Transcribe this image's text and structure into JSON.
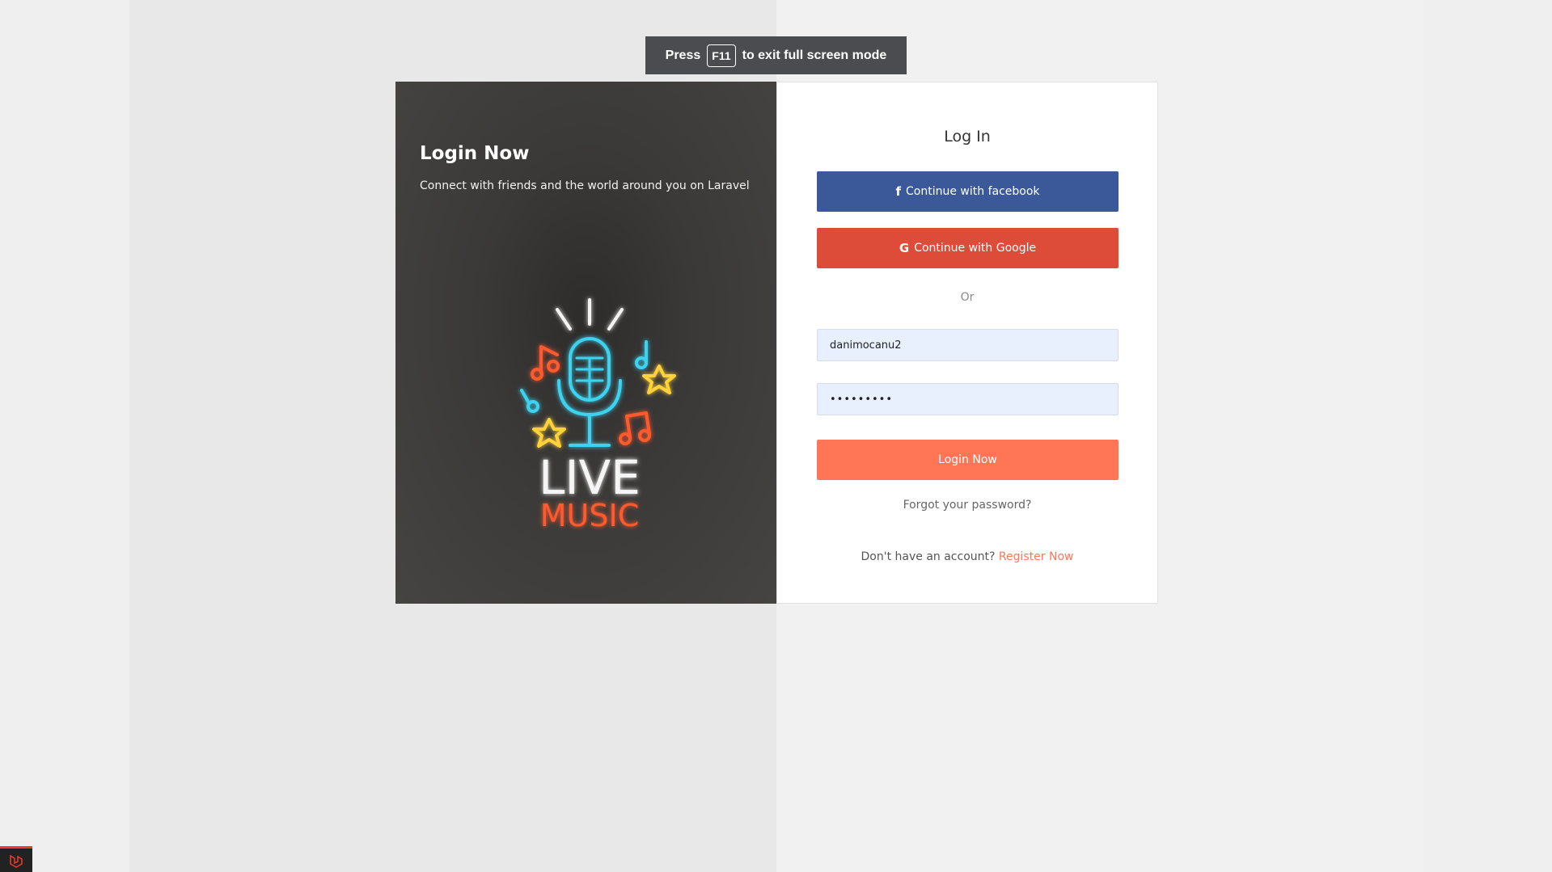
{
  "fullscreen_banner": {
    "press": "Press",
    "key": "F11",
    "rest": "to exit full screen mode"
  },
  "left_panel": {
    "title": "Login Now",
    "subtitle": "Connect with friends and the world around you on Laravel",
    "logo_text_top": "LIVE",
    "logo_text_bottom": "MUSIC"
  },
  "login_form": {
    "title": "Log In",
    "facebook_label": "Continue with facebook",
    "google_label": "Continue with Google",
    "or_label": "Or",
    "username_value": "danimocanu2",
    "password_value": "•••••••••",
    "submit_label": "Login Now",
    "forgot_label": "Forgot your password?",
    "no_account_label": "Don't have an account?",
    "register_label": "Register Now"
  },
  "colors": {
    "facebook": "#3b5998",
    "google": "#dd4b39",
    "accent": "#ff7657"
  }
}
